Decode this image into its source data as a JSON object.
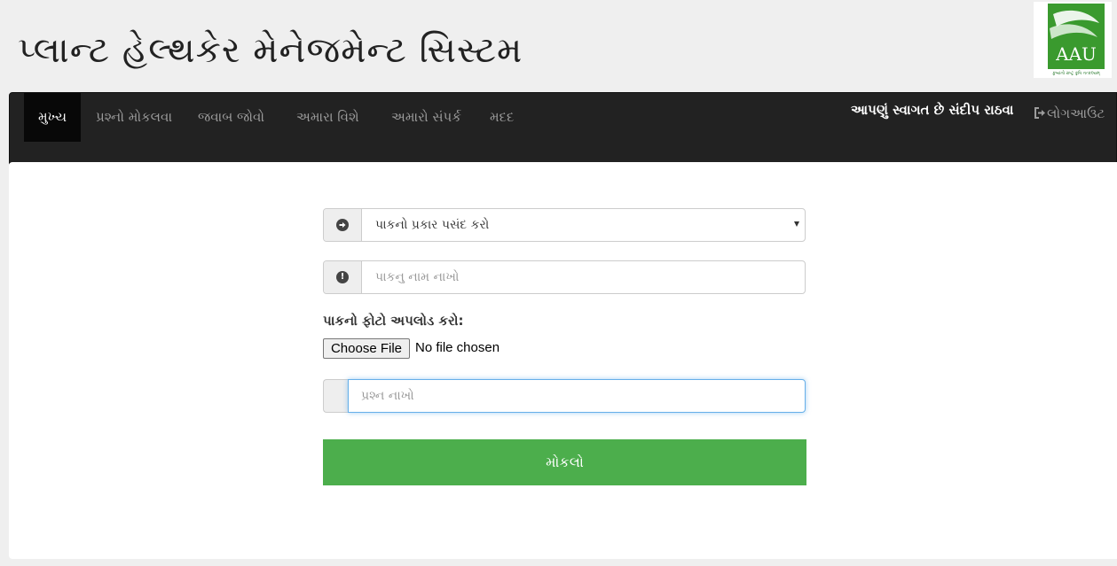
{
  "header": {
    "site_title": "પ્લાન્ટ હેલ્થકેર મેનેજમેન્ટ સિસ્ટમ",
    "logo_text": "AAU",
    "logo_subtext": "કૃષ્યંતો રાષ્ટ્ર કૃષિ તત્કલ્યમ્"
  },
  "nav": {
    "items": [
      {
        "label": "મુખ્ય",
        "active": true
      },
      {
        "label": "પ્રશ્નો મોકલવા",
        "active": false
      },
      {
        "label": "જવાબ જોવો",
        "active": false
      },
      {
        "label": "અમારા વિશે",
        "active": false
      },
      {
        "label": "અમારો સંપર્ક",
        "active": false
      },
      {
        "label": "મદદ",
        "active": false
      }
    ],
    "welcome": "આપણું સ્વાગત છે સંદીપ રાઠવા",
    "logout": "લોગઆઉટ"
  },
  "form": {
    "crop_type_select": {
      "selected": "પાકનો પ્રકાર પસંદ કરો",
      "icon": "arrow-circle-right-icon"
    },
    "crop_name_input": {
      "placeholder": "પાકનુ નામ નાખો",
      "icon": "exclamation-circle-icon"
    },
    "upload_label": "પાકનો ફોટો અપલોડ કરો:",
    "choose_file_button": "Choose File",
    "no_file_text": "No file chosen",
    "question_input": {
      "placeholder": "પ્રશ્ન નાખો"
    },
    "submit_button": "મોકલો"
  },
  "colors": {
    "navbar_bg": "#222222",
    "active_nav_bg": "#080808",
    "submit_bg": "#4cae4c",
    "page_bg": "#efefef",
    "logo_green": "#3a9a2e"
  }
}
